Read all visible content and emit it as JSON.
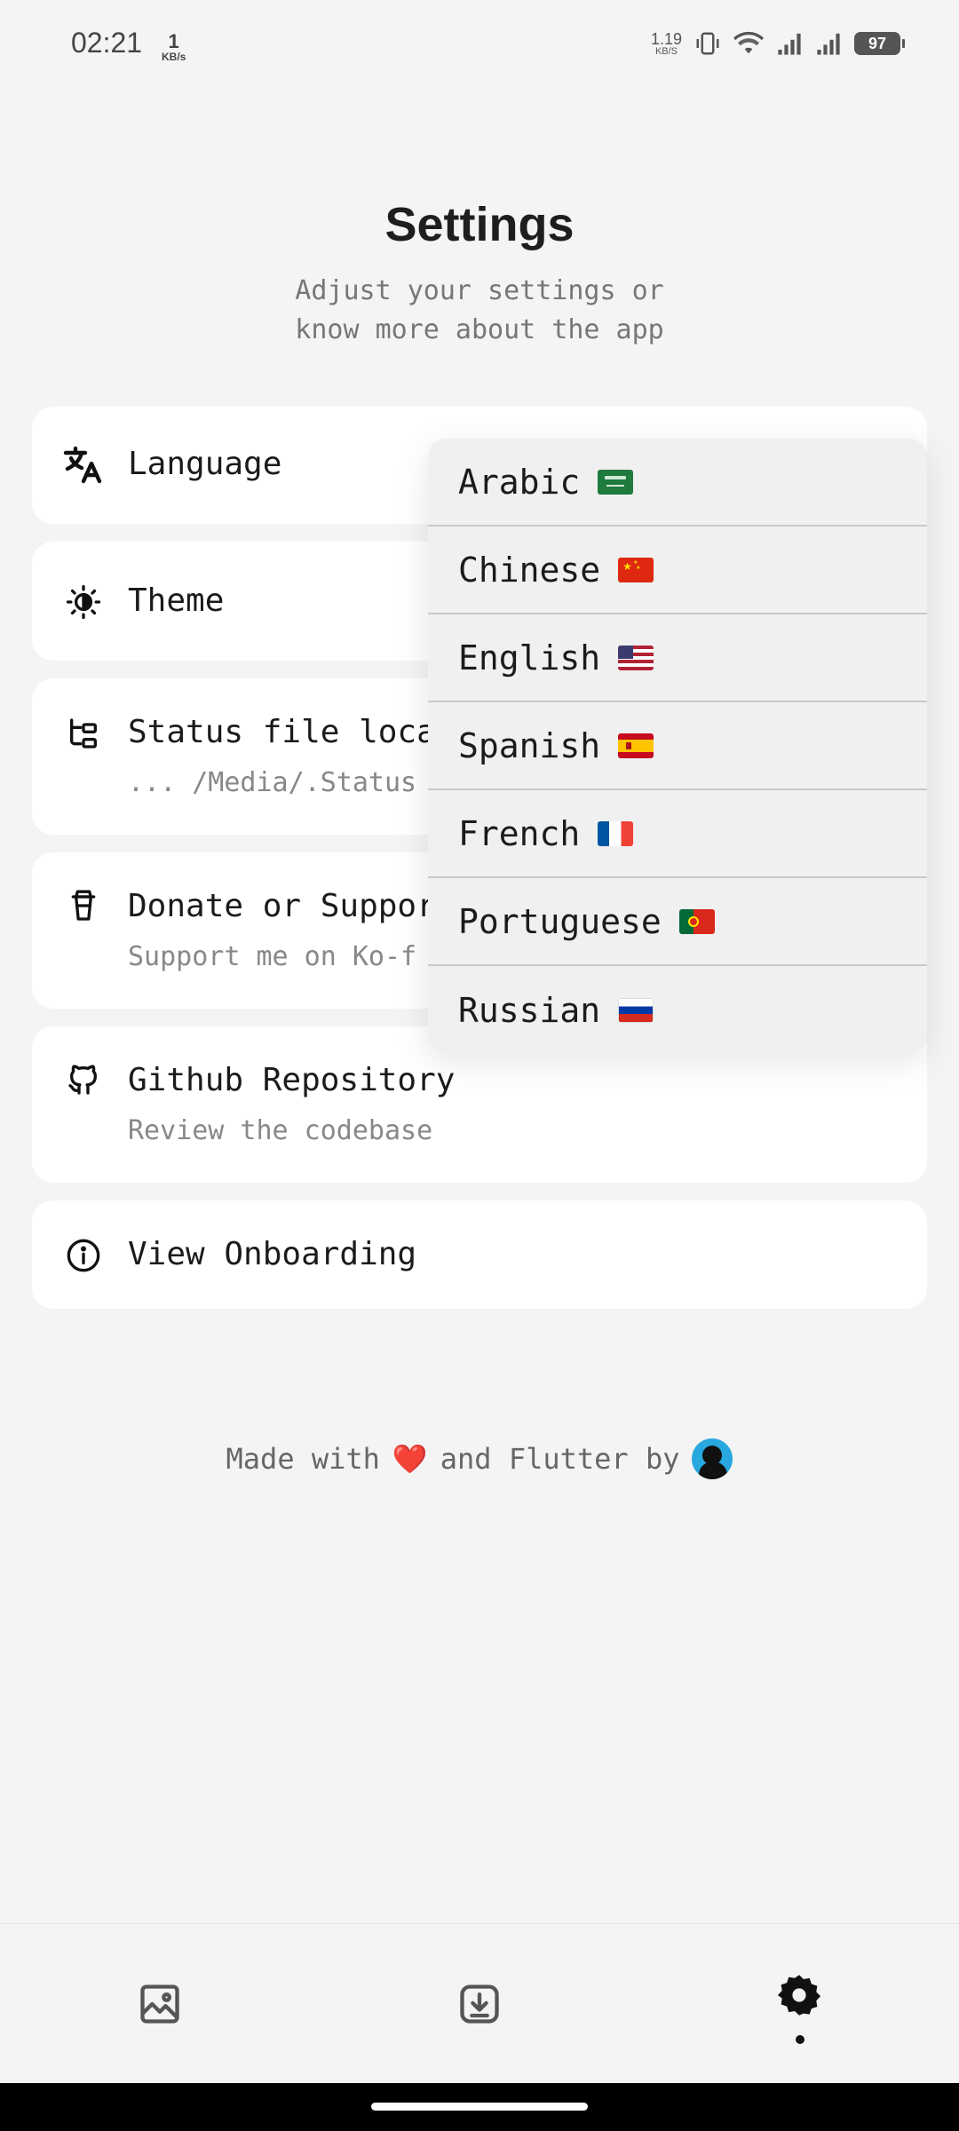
{
  "status_bar": {
    "time": "02:21",
    "speed_value": "1",
    "speed_unit": "KB/s",
    "net_value": "1.19",
    "net_unit": "KB/S",
    "battery": "97"
  },
  "header": {
    "title": "Settings",
    "subtitle": "Adjust your settings or\nknow more about the app"
  },
  "settings": {
    "language": {
      "label": "Language",
      "icon": "translate-icon"
    },
    "theme": {
      "label": "Theme",
      "icon": "contrast-icon"
    },
    "status_location": {
      "label": "Status file loca",
      "sub": "... /Media/.Status",
      "icon": "folder-tree-icon"
    },
    "donate": {
      "label": "Donate or Suppor",
      "sub": "Support me on Ko-f",
      "icon": "coffee-cup-icon"
    },
    "github": {
      "label": "Github Repository",
      "sub": "Review the codebase",
      "icon": "github-icon"
    },
    "onboarding": {
      "label": "View Onboarding",
      "icon": "info-icon"
    }
  },
  "language_menu": {
    "items": [
      {
        "label": "Arabic",
        "flag": "saudi-arabia-flag"
      },
      {
        "label": "Chinese",
        "flag": "china-flag"
      },
      {
        "label": "English",
        "flag": "usa-flag"
      },
      {
        "label": "Spanish",
        "flag": "spain-flag"
      },
      {
        "label": "French",
        "flag": "france-flag"
      },
      {
        "label": "Portuguese",
        "flag": "portugal-flag"
      },
      {
        "label": "Russian",
        "flag": "russia-flag"
      }
    ]
  },
  "footer": {
    "made_with": "Made with",
    "heart": "❤️",
    "and_flutter_by": "and Flutter by"
  },
  "bottom_nav": {
    "items": [
      {
        "name": "gallery",
        "icon": "image-icon"
      },
      {
        "name": "downloads",
        "icon": "download-icon"
      },
      {
        "name": "settings",
        "icon": "gear-icon",
        "active": true
      }
    ]
  }
}
